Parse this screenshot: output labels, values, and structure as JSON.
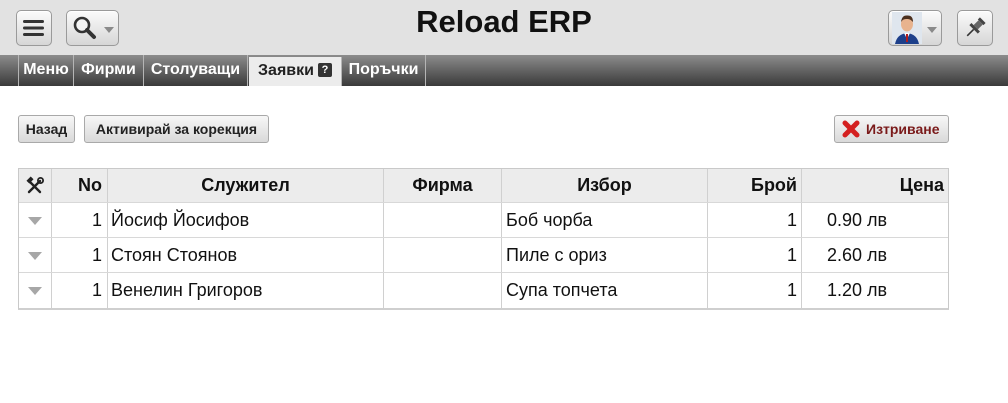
{
  "app": {
    "title": "Reload ERP"
  },
  "header": {
    "menu_icon": "hamburger-menu-icon",
    "search_icon": "magnifier-icon",
    "user_icon": "user-avatar-icon",
    "pin_icon": "pushpin-icon"
  },
  "tabs": [
    {
      "label": "Меню",
      "active": false
    },
    {
      "label": "Фирми",
      "active": false
    },
    {
      "label": "Столуващи",
      "active": false
    },
    {
      "label": "Заявки",
      "active": true,
      "help": "?"
    },
    {
      "label": "Поръчки",
      "active": false
    }
  ],
  "actions": {
    "back_label": "Назад",
    "activate_label": "Активирай за корекция",
    "delete_label": "Изтриване",
    "delete_icon": "red-x-icon"
  },
  "table": {
    "tools_icon": "tools-icon",
    "columns": [
      "No",
      "Служител",
      "Фирма",
      "Избор",
      "Брой",
      "Цена"
    ],
    "rows": [
      {
        "no": "1",
        "employee": "Йосиф Йосифов",
        "firm": "",
        "choice": "Боб чорба",
        "count": "1",
        "price": "0.90 лв"
      },
      {
        "no": "1",
        "employee": "Стоян Стоянов",
        "firm": "",
        "choice": "Пиле с ориз",
        "count": "1",
        "price": "2.60 лв"
      },
      {
        "no": "1",
        "employee": "Венелин Григоров",
        "firm": "",
        "choice": "Супа топчета",
        "count": "1",
        "price": "1.20 лв"
      }
    ]
  },
  "colors": {
    "header_bg": "#e2e2e2",
    "tabbar_top": "#8c8c8c",
    "tabbar_bottom": "#3a3a3a",
    "delete_red": "#d42020"
  }
}
